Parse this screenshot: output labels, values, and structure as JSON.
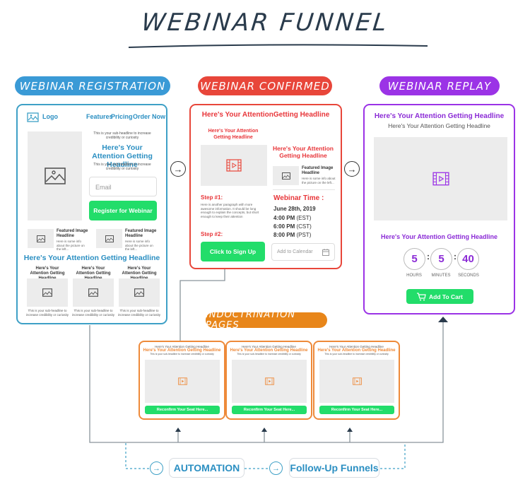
{
  "title": "WEBINAR FUNNEL",
  "stages": {
    "registration": "WEBINAR REGISTRATION",
    "confirmed": "WEBINAR CONFIRMED",
    "replay": "WEBINAR REPLAY",
    "indoctrination": "INDOCTRINATION PAGES"
  },
  "colors": {
    "registration": "#3a9ad6",
    "confirmed": "#e8463a",
    "replay": "#9b33e6",
    "indoctrination": "#e8861a",
    "cta": "#22dd6a"
  },
  "registration_page": {
    "logo": "Logo",
    "nav": [
      "Features",
      "Pricing",
      "Order Now"
    ],
    "subheadline_top": "This is your sub-headline to increase credibility or curiosity",
    "headline": "Here's Your Attention Getting Headline",
    "subheadline_bottom": "This is your sub-headline to increase credibility or curiosity",
    "email_placeholder": "Email",
    "register_button": "Register for Webinar",
    "featured": [
      {
        "title": "Featured Image Headline",
        "text": "Here is some info about the picture on the left..."
      },
      {
        "title": "Featured Image Headline",
        "text": "Here is some info about the picture on the left..."
      }
    ],
    "section_headline": "Here's Your Attention Getting Headline",
    "columns": [
      {
        "title": "Here's Your Attention Getting Headline",
        "text": "This is your sub-headline to increase credibility or curiosity"
      },
      {
        "title": "Here's Your Attention Getting Headline",
        "text": "This is your sub-headline to increase credibility or curiosity"
      },
      {
        "title": "Here's Your Attention Getting Headline",
        "text": "This is your sub-headline to increase credibility or curiosity"
      }
    ]
  },
  "confirmed_page": {
    "headline": "Here's Your AttentionGetting Headline",
    "video_headline": "Here's Your Attention Getting Headline",
    "side_headline": "Here's Your Attention Getting Headline",
    "featured": {
      "title": "Featured Image Headline",
      "text": "Here is some info about the picture on the left..."
    },
    "step1_label": "Step #1:",
    "step1_text": "Here is another paragraph with more awesome information. It should be long enough to explain the concepts, but short enough to keep their attention",
    "step2_label": "Step #2:",
    "signup_button": "Click to Sign Up",
    "webinar_time_label": "Webinar Time :",
    "date": "June 28th, 2019",
    "times": [
      {
        "time": "4:00 PM",
        "zone": "(EST)"
      },
      {
        "time": "6:00 PM",
        "zone": "(CST)"
      },
      {
        "time": "8:00 PM",
        "zone": "(PST)"
      }
    ],
    "calendar_placeholder": "Add to Calendar"
  },
  "replay_page": {
    "headline": "Here's Your Attention Getting Headline",
    "subheadline": "Here's Your Attention Getting Headline",
    "countdown_headline": "Here's Your Attention Getting Headline",
    "countdown": [
      {
        "value": "5",
        "label": "HOURS"
      },
      {
        "value": "5",
        "label": "MINUTES"
      },
      {
        "value": "40",
        "label": "SECONDS"
      }
    ],
    "separator": ":",
    "cart_button": "Add To Cart"
  },
  "indoctrination_pages": [
    {
      "top": "Here's Your Attention Getting Headline",
      "headline": "Here's Your Attention Getting Headline",
      "sub": "This is your sub-headline to increase credibility or curiosity",
      "button": "Reconfirm Your Seat Here..."
    },
    {
      "top": "Here's Your Attention Getting Headline",
      "headline": "Here's Your Attention Getting Headline",
      "sub": "This is your sub-headline to increase credibility or curiosity",
      "button": "Reconfirm Your Seat Here..."
    },
    {
      "top": "Here's Your Attention Getting Headline",
      "headline": "Here's Your Attention Getting Headline",
      "sub": "This is your sub-headline to increase credibility or curiosity",
      "button": "Reconfirm Your Seat Here..."
    }
  ],
  "bottom": {
    "automation": "AUTOMATION",
    "followup": "Follow-Up Funnels"
  }
}
